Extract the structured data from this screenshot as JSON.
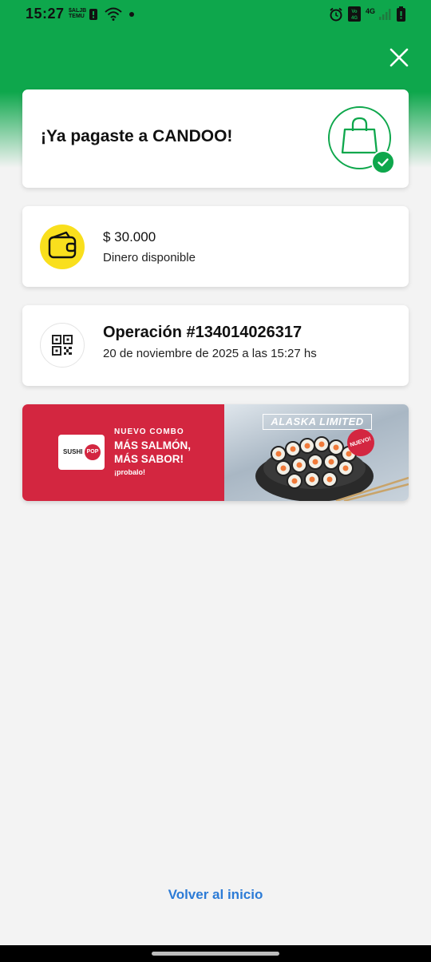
{
  "status_bar": {
    "time": "15:27",
    "small_text_1": "$ALJB",
    "small_text_2": "TEMU",
    "network_label": "4G",
    "icons": [
      "notification-icon",
      "wifi-icon",
      "dot-icon",
      "alarm-icon",
      "volte-icon",
      "signal-icon",
      "battery-icon"
    ]
  },
  "header": {
    "close_icon": "close-icon",
    "accent_color": "#0ea74c"
  },
  "success_card": {
    "title": "¡Ya pagaste a CANDOO!",
    "icon": "shopping-bag-icon",
    "badge_icon": "check-icon"
  },
  "balance_card": {
    "icon": "wallet-icon",
    "icon_color": "#f9df1d",
    "amount": "$ 30.000",
    "label": "Dinero disponible"
  },
  "operation_card": {
    "icon": "qr-code-icon",
    "title": "Operación #134014026317",
    "date": "20 de noviembre de 2025 a las 15:27 hs"
  },
  "promo_banner": {
    "brand_left": "SUSHI",
    "brand_right": "POP",
    "tag": "NUEVO COMBO",
    "headline_line1": "MÁS SALMÓN,",
    "headline_line2": "MÁS SABOR!",
    "cta": "¡probalo!",
    "product_name": "ALASKA LIMITED",
    "badge": "NUEVO!",
    "banner_color": "#d32640"
  },
  "footer": {
    "back_link": "Volver al inicio",
    "link_color": "#2c7bd6"
  }
}
